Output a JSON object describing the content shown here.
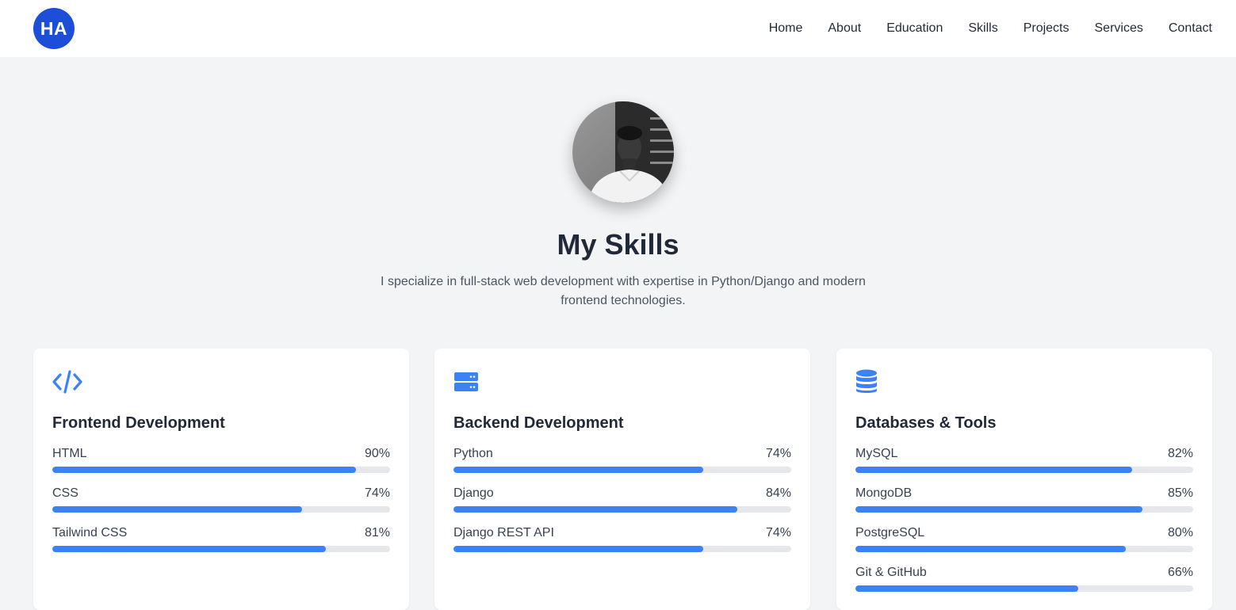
{
  "nav": {
    "logo": "HA",
    "links": [
      "Home",
      "About",
      "Education",
      "Skills",
      "Projects",
      "Services",
      "Contact"
    ]
  },
  "hero": {
    "title": "My Skills",
    "subtitle": "I specialize in full-stack web development with expertise in Python/Django and modern frontend technologies."
  },
  "colors": {
    "accent": "#3b82f6",
    "logo_bg": "#1d4ed8",
    "track": "#e5e7eb"
  },
  "cards": [
    {
      "icon": "code-icon",
      "title": "Frontend Development",
      "skills": [
        {
          "name": "HTML",
          "percent_label": "90%",
          "level": 0.9
        },
        {
          "name": "CSS",
          "percent_label": "74%",
          "level": 0.74
        },
        {
          "name": "Tailwind CSS",
          "percent_label": "81%",
          "level": 0.81
        }
      ]
    },
    {
      "icon": "server-icon",
      "title": "Backend Development",
      "skills": [
        {
          "name": "Python",
          "percent_label": "74%",
          "level": 0.74
        },
        {
          "name": "Django",
          "percent_label": "84%",
          "level": 0.84
        },
        {
          "name": "Django REST API",
          "percent_label": "74%",
          "level": 0.74
        }
      ]
    },
    {
      "icon": "database-icon",
      "title": "Databases & Tools",
      "skills": [
        {
          "name": "MySQL",
          "percent_label": "82%",
          "level": 0.82
        },
        {
          "name": "MongoDB",
          "percent_label": "85%",
          "level": 0.85
        },
        {
          "name": "PostgreSQL",
          "percent_label": "80%",
          "level": 0.8
        },
        {
          "name": "Git & GitHub",
          "percent_label": "66%",
          "level": 0.66
        }
      ]
    }
  ]
}
